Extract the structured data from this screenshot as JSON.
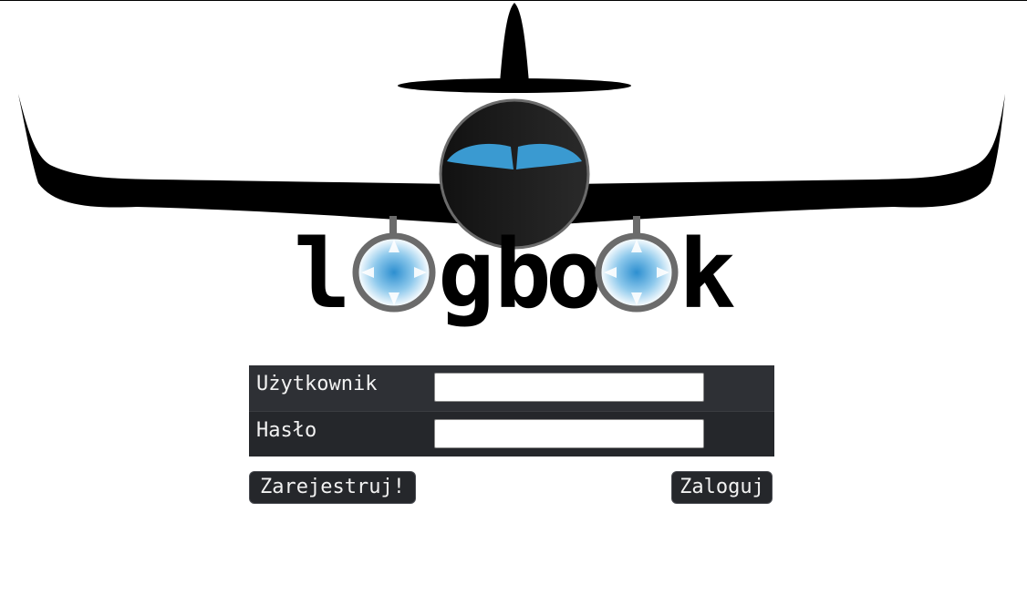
{
  "logo": {
    "letters": [
      "l",
      "g",
      "b",
      "o",
      "k"
    ],
    "alt_text": "logboOk",
    "colors": {
      "fuselage": "#000000",
      "cockpit_glass": "#3a9ad1",
      "engine_ring": "#6b6b6b",
      "engine_glow": "#3a9ad1"
    }
  },
  "form": {
    "rows": [
      {
        "label": "Użytkownik",
        "input_type": "text",
        "value": "",
        "placeholder": ""
      },
      {
        "label": "Hasło",
        "input_type": "password",
        "value": "",
        "placeholder": ""
      }
    ],
    "colors": {
      "row_bg_1": "#2e3035",
      "row_bg_2": "#25272b",
      "label_text": "#f2f2f2"
    }
  },
  "actions": {
    "register_label": "Zarejestruj!",
    "login_label": "Zaloguj"
  }
}
